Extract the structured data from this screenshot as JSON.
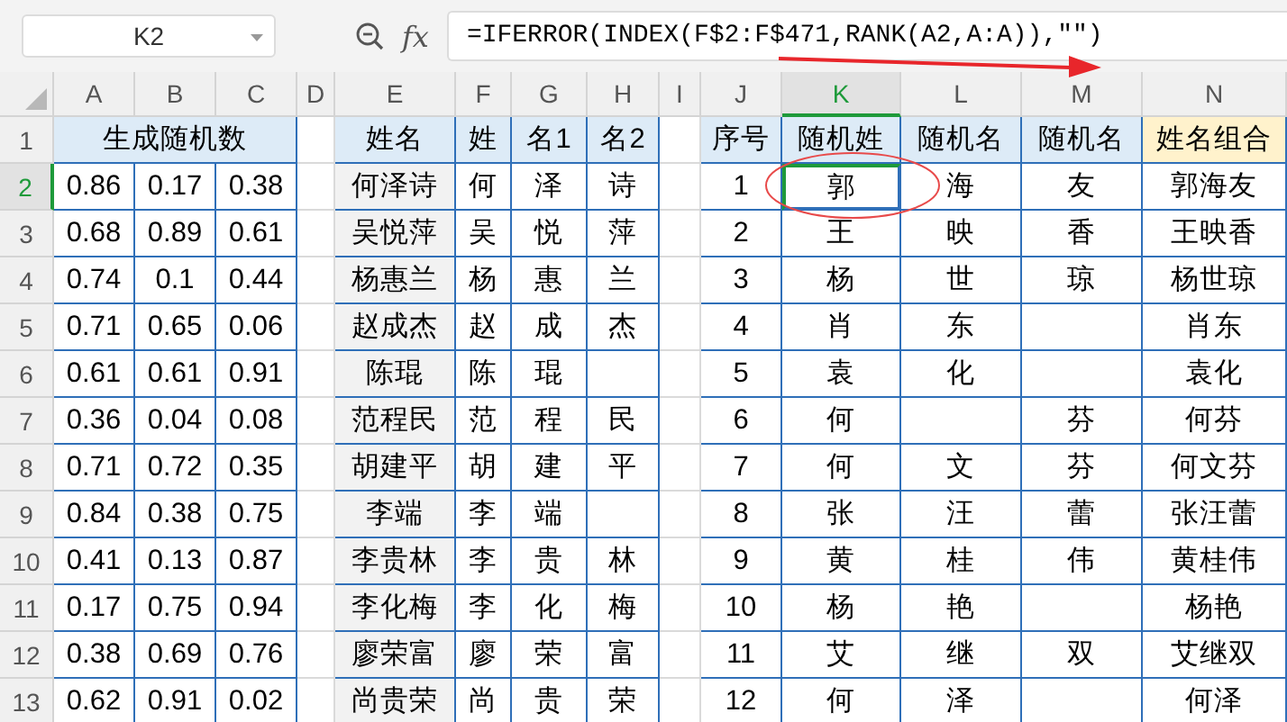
{
  "name_box": "K2",
  "fx_label": "fx",
  "formula": "=IFERROR(INDEX(F$2:F$471,RANK(A2,A:A)),\"\")",
  "columns": [
    {
      "label": "A",
      "selected": false
    },
    {
      "label": "B",
      "selected": false
    },
    {
      "label": "C",
      "selected": false
    },
    {
      "label": "D",
      "selected": false
    },
    {
      "label": "E",
      "selected": false
    },
    {
      "label": "F",
      "selected": false
    },
    {
      "label": "G",
      "selected": false
    },
    {
      "label": "H",
      "selected": false
    },
    {
      "label": "I",
      "selected": false
    },
    {
      "label": "J",
      "selected": false
    },
    {
      "label": "K",
      "selected": true
    },
    {
      "label": "L",
      "selected": false
    },
    {
      "label": "M",
      "selected": false
    },
    {
      "label": "N",
      "selected": false
    }
  ],
  "header": {
    "row_number": "1",
    "random_title": "生成随机数",
    "name_headers": [
      "姓名",
      "姓",
      "名1",
      "名2"
    ],
    "result_headers": [
      "序号",
      "随机姓",
      "随机名",
      "随机名",
      "姓名组合"
    ]
  },
  "rows": [
    {
      "row_number": "2",
      "selected": true,
      "randoms": [
        "0.86",
        "0.17",
        "0.38"
      ],
      "full": "何泽诗",
      "surname": "何",
      "given1": "泽",
      "given2": "诗",
      "seq": "1",
      "r_surname": "郭",
      "surname_selected": true,
      "r_given1": "海",
      "r_given2": "友",
      "combined": "郭海友"
    },
    {
      "row_number": "3",
      "selected": false,
      "randoms": [
        "0.68",
        "0.89",
        "0.61"
      ],
      "full": "吴悦萍",
      "surname": "吴",
      "given1": "悦",
      "given2": "萍",
      "seq": "2",
      "r_surname": "王",
      "surname_selected": false,
      "r_given1": "映",
      "r_given2": "香",
      "combined": "王映香"
    },
    {
      "row_number": "4",
      "selected": false,
      "randoms": [
        "0.74",
        "0.1",
        "0.44"
      ],
      "full": "杨惠兰",
      "surname": "杨",
      "given1": "惠",
      "given2": "兰",
      "seq": "3",
      "r_surname": "杨",
      "surname_selected": false,
      "r_given1": "世",
      "r_given2": "琼",
      "combined": "杨世琼"
    },
    {
      "row_number": "5",
      "selected": false,
      "randoms": [
        "0.71",
        "0.65",
        "0.06"
      ],
      "full": "赵成杰",
      "surname": "赵",
      "given1": "成",
      "given2": "杰",
      "seq": "4",
      "r_surname": "肖",
      "surname_selected": false,
      "r_given1": "东",
      "combined": "肖东"
    },
    {
      "row_number": "6",
      "selected": false,
      "randoms": [
        "0.61",
        "0.61",
        "0.91"
      ],
      "full": "陈琨",
      "surname": "陈",
      "given1": "琨",
      "seq": "5",
      "r_surname": "袁",
      "surname_selected": false,
      "r_given1": "化",
      "combined": "袁化"
    },
    {
      "row_number": "7",
      "selected": false,
      "randoms": [
        "0.36",
        "0.04",
        "0.08"
      ],
      "full": "范程民",
      "surname": "范",
      "given1": "程",
      "given2": "民",
      "seq": "6",
      "r_surname": "何",
      "surname_selected": false,
      "r_given2": "芬",
      "combined": "何芬"
    },
    {
      "row_number": "8",
      "selected": false,
      "randoms": [
        "0.71",
        "0.72",
        "0.35"
      ],
      "full": "胡建平",
      "surname": "胡",
      "given1": "建",
      "given2": "平",
      "seq": "7",
      "r_surname": "何",
      "surname_selected": false,
      "r_given1": "文",
      "r_given2": "芬",
      "combined": "何文芬"
    },
    {
      "row_number": "9",
      "selected": false,
      "randoms": [
        "0.84",
        "0.38",
        "0.75"
      ],
      "full": "李端",
      "surname": "李",
      "given1": "端",
      "seq": "8",
      "r_surname": "张",
      "surname_selected": false,
      "r_given1": "汪",
      "r_given2": "蕾",
      "combined": "张汪蕾"
    },
    {
      "row_number": "10",
      "selected": false,
      "randoms": [
        "0.41",
        "0.13",
        "0.87"
      ],
      "full": "李贵林",
      "surname": "李",
      "given1": "贵",
      "given2": "林",
      "seq": "9",
      "r_surname": "黄",
      "surname_selected": false,
      "r_given1": "桂",
      "r_given2": "伟",
      "combined": "黄桂伟"
    },
    {
      "row_number": "11",
      "selected": false,
      "randoms": [
        "0.17",
        "0.75",
        "0.94"
      ],
      "full": "李化梅",
      "surname": "李",
      "given1": "化",
      "given2": "梅",
      "seq": "10",
      "r_surname": "杨",
      "surname_selected": false,
      "r_given1": "艳",
      "combined": "杨艳"
    },
    {
      "row_number": "12",
      "selected": false,
      "randoms": [
        "0.38",
        "0.69",
        "0.76"
      ],
      "full": "廖荣富",
      "surname": "廖",
      "given1": "荣",
      "given2": "富",
      "seq": "11",
      "r_surname": "艾",
      "surname_selected": false,
      "r_given1": "继",
      "r_given2": "双",
      "combined": "艾继双"
    },
    {
      "row_number": "13",
      "selected": false,
      "randoms": [
        "0.62",
        "0.91",
        "0.02"
      ],
      "full": "尚贵荣",
      "surname": "尚",
      "given1": "贵",
      "given2": "荣",
      "seq": "12",
      "r_surname": "何",
      "surname_selected": false,
      "r_given1": "泽",
      "combined": "何泽"
    }
  ]
}
